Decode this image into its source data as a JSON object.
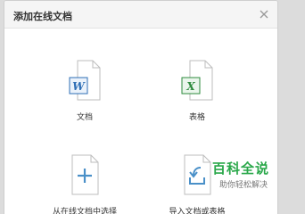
{
  "dialog": {
    "title": "添加在线文档",
    "close_icon": "close-icon"
  },
  "options": {
    "doc": {
      "label": "文档",
      "badge": "W",
      "icon": "word-document-icon",
      "color": "#2f6fb6"
    },
    "sheet": {
      "label": "表格",
      "badge": "X",
      "icon": "excel-sheet-icon",
      "color": "#2e8b3e"
    },
    "pick": {
      "label": "从在线文档中选择",
      "icon": "add-document-icon",
      "color": "#4a90c8"
    },
    "import": {
      "label": "导入文档或表格",
      "icon": "import-document-icon",
      "color": "#4a90c8"
    }
  },
  "watermark": {
    "title": "百科全说",
    "subtitle": "助你轻松解决"
  }
}
